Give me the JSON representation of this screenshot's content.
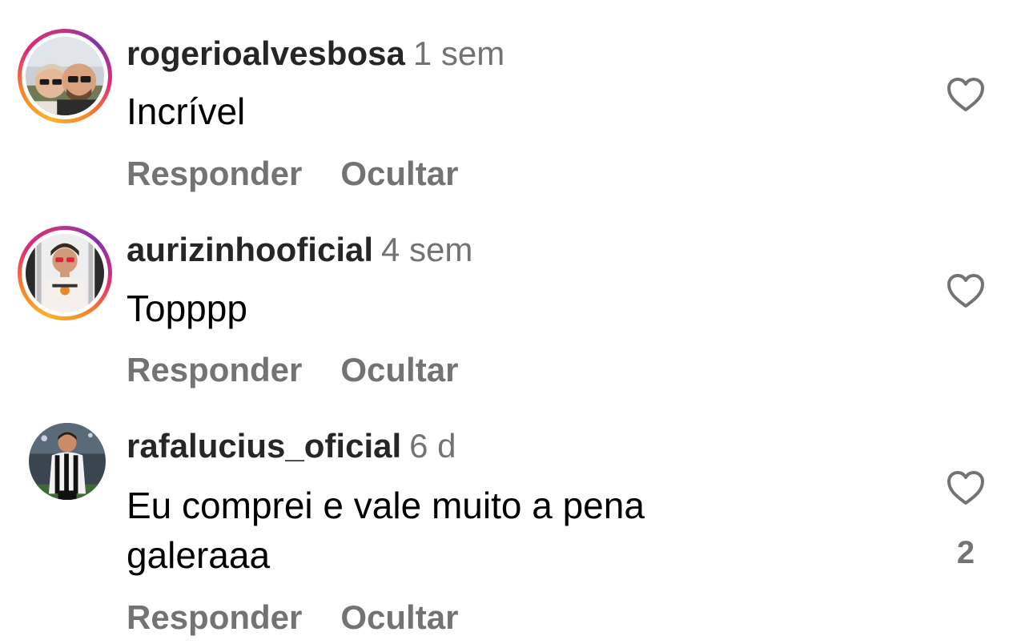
{
  "comments": [
    {
      "username": "rogerioalvesbosa",
      "time": "1 sem",
      "text": "Incrível",
      "reply_label": "Responder",
      "hide_label": "Ocultar",
      "like_count": null,
      "has_story_ring": true
    },
    {
      "username": "aurizinhooficial",
      "time": "4 sem",
      "text": "Topppp",
      "reply_label": "Responder",
      "hide_label": "Ocultar",
      "like_count": null,
      "has_story_ring": true
    },
    {
      "username": "rafalucius_oficial",
      "time": "6 d",
      "text": "Eu comprei e vale muito a pena galeraaa",
      "reply_label": "Responder",
      "hide_label": "Ocultar",
      "like_count": "2",
      "has_story_ring": false
    }
  ],
  "colors": {
    "secondary_text": "#737373",
    "primary_text": "#000000",
    "username": "#262626",
    "story_ring": [
      "#f9b22a",
      "#dd2a7b",
      "#8134af"
    ]
  },
  "icons": {
    "like": "heart-outline-icon"
  }
}
